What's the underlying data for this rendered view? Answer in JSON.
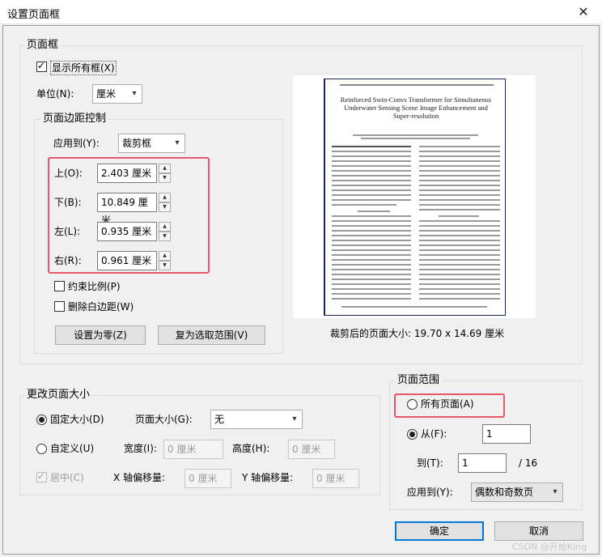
{
  "window": {
    "title": "设置页面框",
    "close_icon": "close-icon"
  },
  "page_box": {
    "legend": "页面框",
    "show_all": {
      "label": "显示所有框(X)",
      "checked": true
    },
    "unit": {
      "label": "单位(N):",
      "value": "厘米"
    }
  },
  "margin_ctrl": {
    "legend": "页面边距控制",
    "apply_to": {
      "label": "应用到(Y):",
      "value": "裁剪框"
    },
    "top": {
      "label": "上(O):",
      "value": "2.403 厘米"
    },
    "bottom": {
      "label": "下(B):",
      "value": "10.849 厘米"
    },
    "left": {
      "label": "左(L):",
      "value": "0.935 厘米"
    },
    "right": {
      "label": "右(R):",
      "value": "0.961 厘米"
    },
    "constrain": {
      "label": "约束比例(P)",
      "checked": false
    },
    "remove_white": {
      "label": "删除白边距(W)",
      "checked": false
    },
    "set_zero_btn": "设置为零(Z)",
    "revert_btn": "复为选取范围(V)"
  },
  "preview": {
    "doc_title": "Reinforced Swin-Convs Transformer for Simultaneous Underwater Sensing Scene Image Enhancement and Super-resolution",
    "cropped_size_label": "裁剪后的页面大小: 19.70 x 14.69 厘米"
  },
  "change_size": {
    "legend": "更改页面大小",
    "fixed": {
      "label": "固定大小(D)",
      "selected": true
    },
    "page_size": {
      "label": "页面大小(G):",
      "value": "无"
    },
    "custom": {
      "label": "自定义(U)",
      "selected": false
    },
    "width": {
      "label": "宽度(I):",
      "value": "0 厘米"
    },
    "height": {
      "label": "高度(H):",
      "value": "0 厘米"
    },
    "center": {
      "label": "居中(C)",
      "checked": true
    },
    "x_offset": {
      "label": "X 轴偏移量:",
      "value": "0 厘米"
    },
    "y_offset": {
      "label": "Y 轴偏移量:",
      "value": "0 厘米"
    }
  },
  "page_range": {
    "legend": "页面范围",
    "all_pages": {
      "label": "所有页面(A)",
      "selected": false
    },
    "from": {
      "label": "从(F):",
      "value": "1",
      "selected": true
    },
    "to": {
      "label": "到(T):",
      "value": "1",
      "total": "/ 16"
    },
    "apply_to": {
      "label": "应用到(Y):",
      "value": "偶数和奇数页"
    }
  },
  "buttons": {
    "ok": "确定",
    "cancel": "取消"
  },
  "watermark": "CSDN @开始King",
  "colors": {
    "highlight": "#e8566a",
    "accent": "#0078d7"
  }
}
